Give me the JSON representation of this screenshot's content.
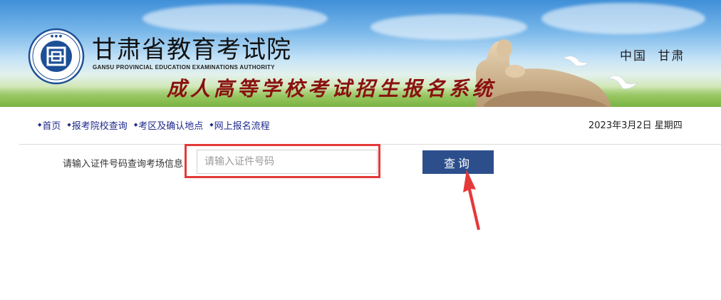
{
  "header": {
    "title": "甘肃省教育考试院",
    "subtitle": "GANSU PROVINCIAL EDUCATION EXAMINATIONS AUTHORITY",
    "system_title": "成人高等学校考试招生报名系统",
    "region": "中国 甘肃",
    "logo": "examination-authority-emblem"
  },
  "nav": {
    "items": [
      {
        "label": "首页"
      },
      {
        "label": "报考院校查询"
      },
      {
        "label": "考区及确认地点"
      },
      {
        "label": "网上报名流程"
      }
    ]
  },
  "date": "2023年3月2日 星期四",
  "search": {
    "label": "请输入证件号码查询考场信息",
    "placeholder": "请输入证件号码",
    "value": "",
    "button_label": "查询"
  },
  "annotation": {
    "highlight_color": "#e53939",
    "arrow_color": "#e53939"
  },
  "colors": {
    "nav_text": "#1f2a8c",
    "button_bg": "#2c4f8c",
    "system_title": "#8a1010"
  }
}
